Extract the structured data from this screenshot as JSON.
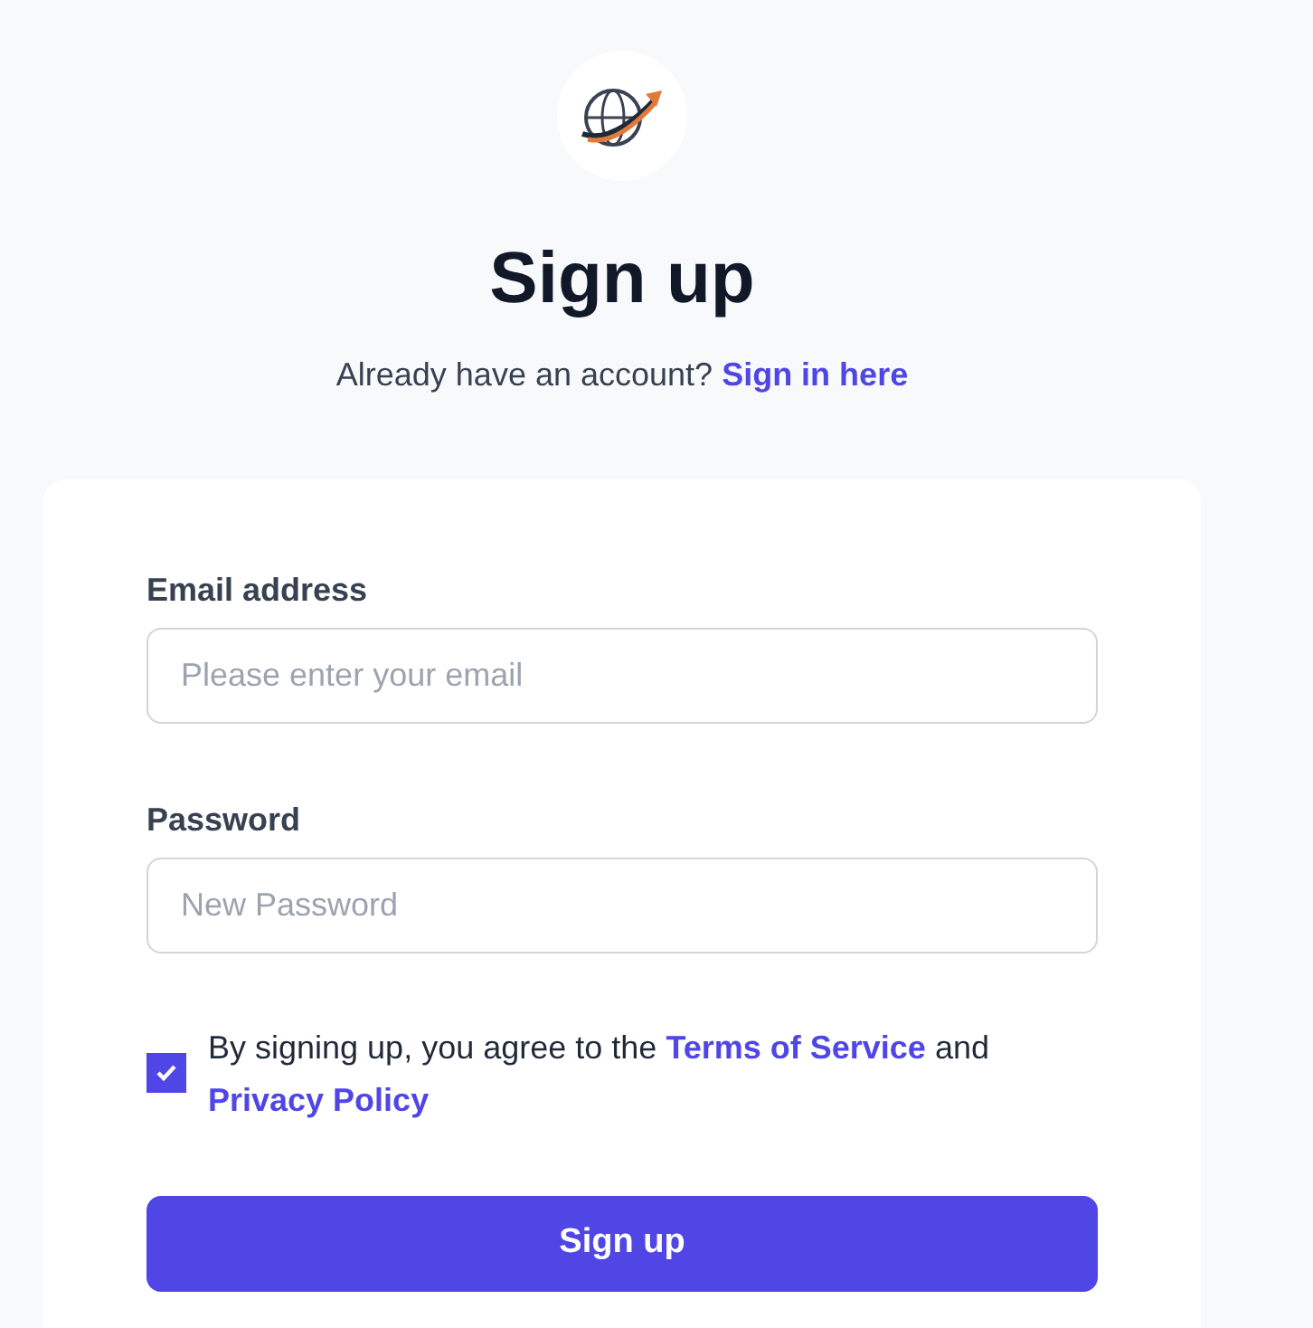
{
  "title": "Sign up",
  "signin_prompt": {
    "text": "Already have an account?",
    "link": "Sign in here"
  },
  "fields": [
    {
      "label": "Email address",
      "placeholder": "Please enter your email"
    },
    {
      "label": "Password",
      "placeholder": "New Password"
    }
  ],
  "agreement": {
    "checked": true,
    "before": "By signing up, you agree to the",
    "terms_link": "Terms of Service",
    "middle": "and",
    "privacy_link": "Privacy Policy"
  },
  "submit_button": "Sign up"
}
